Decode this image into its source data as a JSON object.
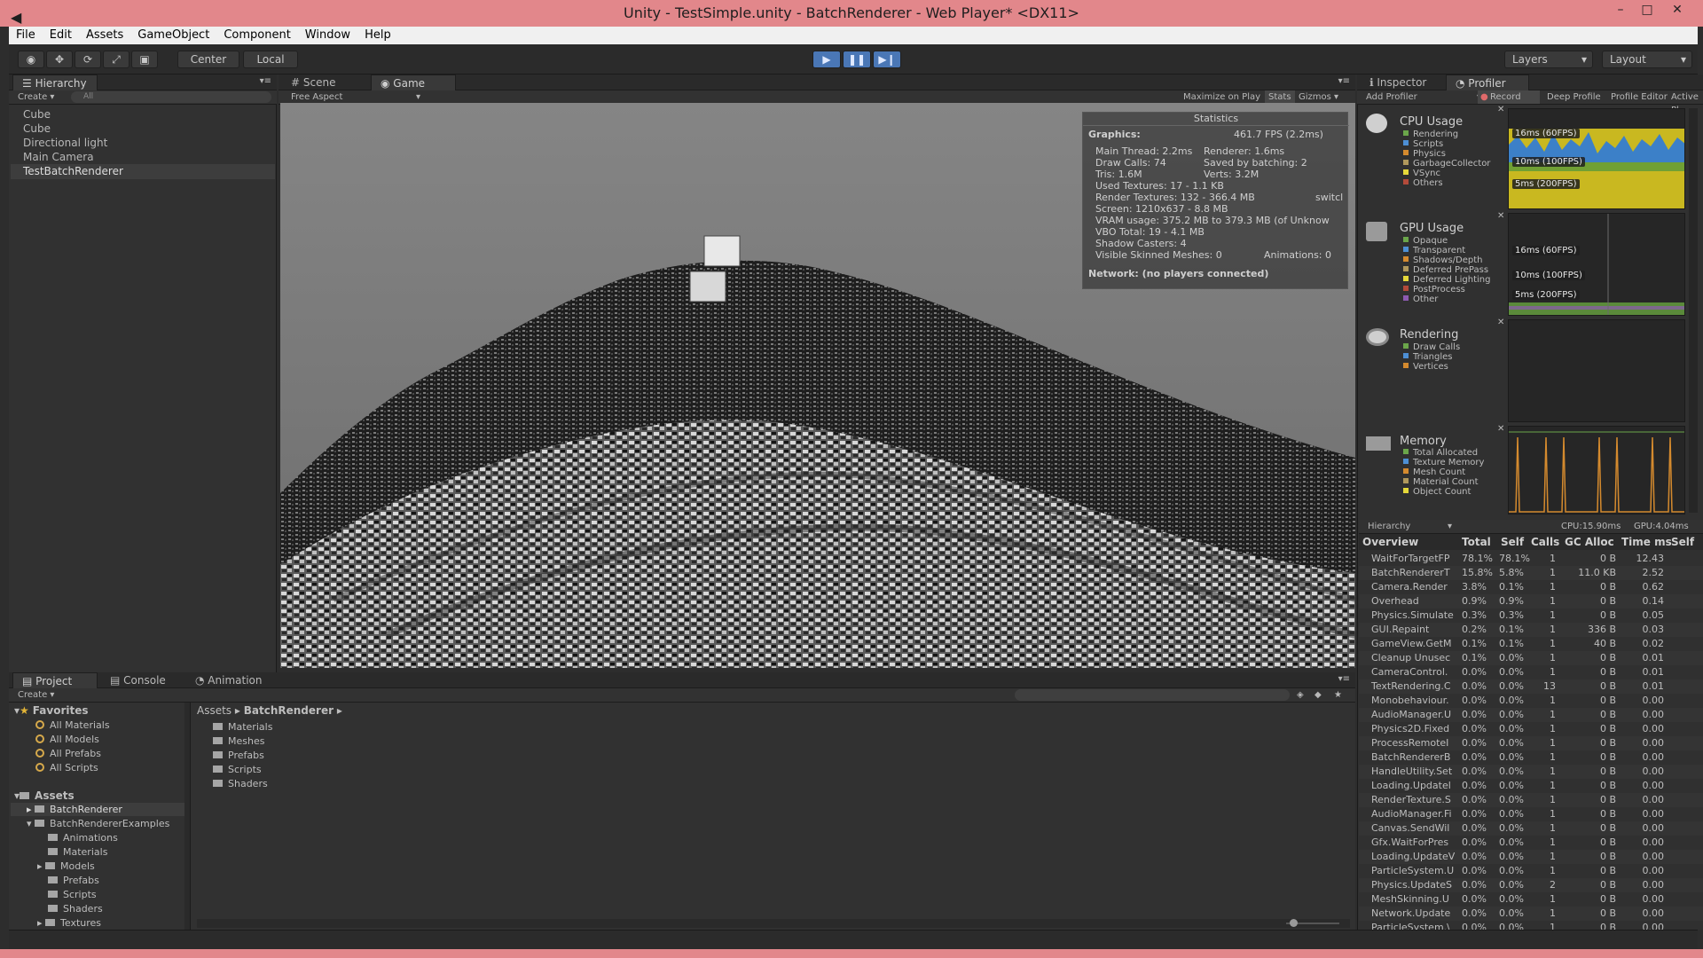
{
  "window": {
    "title": "Unity - TestSimple.unity - BatchRenderer - Web Player* <DX11>",
    "controls": [
      "–",
      "□",
      "✕"
    ]
  },
  "menu": [
    "File",
    "Edit",
    "Assets",
    "GameObject",
    "Component",
    "Window",
    "Help"
  ],
  "toolbar": {
    "center": "Center",
    "local": "Local",
    "layers": "Layers",
    "layout": "Layout"
  },
  "hierarchy": {
    "tab": "Hierarchy",
    "create": "Create",
    "search_placeholder": "All",
    "items": [
      "Cube",
      "Cube",
      "Directional light",
      "Main Camera",
      "TestBatchRenderer"
    ]
  },
  "scene": {
    "tabs": [
      "Scene",
      "Game"
    ],
    "aspect": "Free Aspect",
    "options": [
      "Maximize on Play",
      "Stats",
      "Gizmos"
    ]
  },
  "stats": {
    "header": "Statistics",
    "graphics_label": "Graphics:",
    "fps": "461.7 FPS (2.2ms)",
    "main_thread": "Main Thread: 2.2ms",
    "renderer": "Renderer: 1.6ms",
    "draw_calls": "Draw Calls: 74",
    "saved_batching": "Saved by batching: 2",
    "tris": "Tris: 1.6M",
    "verts": "Verts: 3.2M",
    "used_textures": "Used Textures: 17 - 1.1 KB",
    "render_textures": "Render Textures: 132 - 366.4 MB",
    "switches": "switcl",
    "screen": "Screen: 1210x637 - 8.8 MB",
    "vram": "VRAM usage: 375.2 MB to 379.3 MB (of Unknow",
    "vbo": "VBO Total: 19 - 4.1 MB",
    "shadow_casters": "Shadow Casters: 4",
    "skinned_meshes": "Visible Skinned Meshes: 0",
    "animations": "Animations: 0",
    "network": "Network: (no players connected)"
  },
  "inspector": {
    "tabs": [
      "Inspector",
      "Profiler"
    ],
    "buttons": [
      "Add Profiler",
      "Record",
      "Deep Profile",
      "Profile Editor",
      "Active Pl"
    ],
    "cpu": {
      "label": "CPU Usage",
      "legend": [
        "Rendering",
        "Scripts",
        "Physics",
        "GarbageCollector",
        "VSync",
        "Others"
      ],
      "marks": [
        "16ms (60FPS)",
        "10ms (100FPS)",
        "5ms (200FPS)"
      ]
    },
    "gpu": {
      "label": "GPU Usage",
      "legend": [
        "Opaque",
        "Transparent",
        "Shadows/Depth",
        "Deferred PrePass",
        "Deferred Lighting",
        "PostProcess",
        "Other"
      ],
      "marks": [
        "16ms (60FPS)",
        "10ms (100FPS)",
        "5ms (200FPS)"
      ]
    },
    "rendering": {
      "label": "Rendering",
      "legend": [
        "Draw Calls",
        "Triangles",
        "Vertices"
      ]
    },
    "memory": {
      "label": "Memory",
      "legend": [
        "Total Allocated",
        "Texture Memory",
        "Mesh Count",
        "Material Count",
        "Object Count"
      ]
    },
    "hier_mode": "Hierarchy",
    "cpu_time": "CPU:15.90ms",
    "gpu_time": "GPU:4.04ms",
    "columns": [
      "Overview",
      "Total",
      "Self",
      "Calls",
      "GC Alloc",
      "Time ms",
      "Self"
    ],
    "rows": [
      [
        "WaitForTargetFP",
        "78.1%",
        "78.1%",
        "1",
        "0 B",
        "12.43"
      ],
      [
        "BatchRendererT",
        "15.8%",
        "5.8%",
        "1",
        "11.0 KB",
        "2.52"
      ],
      [
        "Camera.Render",
        "3.8%",
        "0.1%",
        "1",
        "0 B",
        "0.62"
      ],
      [
        "Overhead",
        "0.9%",
        "0.9%",
        "1",
        "0 B",
        "0.14"
      ],
      [
        "Physics.Simulate",
        "0.3%",
        "0.3%",
        "1",
        "0 B",
        "0.05"
      ],
      [
        "GUI.Repaint",
        "0.2%",
        "0.1%",
        "1",
        "336 B",
        "0.03"
      ],
      [
        "GameView.GetM",
        "0.1%",
        "0.1%",
        "1",
        "40 B",
        "0.02"
      ],
      [
        "Cleanup Unusec",
        "0.1%",
        "0.0%",
        "1",
        "0 B",
        "0.01"
      ],
      [
        "CameraControl.",
        "0.0%",
        "0.0%",
        "1",
        "0 B",
        "0.01"
      ],
      [
        "TextRendering.C",
        "0.0%",
        "0.0%",
        "13",
        "0 B",
        "0.01"
      ],
      [
        "Monobehaviour.",
        "0.0%",
        "0.0%",
        "1",
        "0 B",
        "0.00"
      ],
      [
        "AudioManager.U",
        "0.0%",
        "0.0%",
        "1",
        "0 B",
        "0.00"
      ],
      [
        "Physics2D.Fixed",
        "0.0%",
        "0.0%",
        "1",
        "0 B",
        "0.00"
      ],
      [
        "ProcessRemoteI",
        "0.0%",
        "0.0%",
        "1",
        "0 B",
        "0.00"
      ],
      [
        "BatchRendererB",
        "0.0%",
        "0.0%",
        "1",
        "0 B",
        "0.00"
      ],
      [
        "HandleUtility.Set",
        "0.0%",
        "0.0%",
        "1",
        "0 B",
        "0.00"
      ],
      [
        "Loading.Updatel",
        "0.0%",
        "0.0%",
        "1",
        "0 B",
        "0.00"
      ],
      [
        "RenderTexture.S",
        "0.0%",
        "0.0%",
        "1",
        "0 B",
        "0.00"
      ],
      [
        "AudioManager.Fi",
        "0.0%",
        "0.0%",
        "1",
        "0 B",
        "0.00"
      ],
      [
        "Canvas.SendWil",
        "0.0%",
        "0.0%",
        "1",
        "0 B",
        "0.00"
      ],
      [
        "Gfx.WaitForPres",
        "0.0%",
        "0.0%",
        "1",
        "0 B",
        "0.00"
      ],
      [
        "Loading.UpdateV",
        "0.0%",
        "0.0%",
        "1",
        "0 B",
        "0.00"
      ],
      [
        "ParticleSystem.U",
        "0.0%",
        "0.0%",
        "1",
        "0 B",
        "0.00"
      ],
      [
        "Physics.UpdateS",
        "0.0%",
        "0.0%",
        "2",
        "0 B",
        "0.00"
      ],
      [
        "MeshSkinning.U",
        "0.0%",
        "0.0%",
        "1",
        "0 B",
        "0.00"
      ],
      [
        "Network.Update",
        "0.0%",
        "0.0%",
        "1",
        "0 B",
        "0.00"
      ],
      [
        "ParticleSystem.\\",
        "0.0%",
        "0.0%",
        "1",
        "0 B",
        "0.00"
      ]
    ]
  },
  "project": {
    "tabs": [
      "Project",
      "Console",
      "Animation"
    ],
    "create": "Create",
    "favorites_label": "Favorites",
    "favorites": [
      "All Materials",
      "All Models",
      "All Prefabs",
      "All Scripts"
    ],
    "assets_label": "Assets",
    "tree": [
      "BatchRenderer",
      "BatchRendererExamples",
      "Animations",
      "Materials",
      "Models",
      "Prefabs",
      "Scripts",
      "Shaders",
      "Textures"
    ],
    "breadcrumb": [
      "Assets",
      "BatchRenderer"
    ],
    "folders": [
      "Materials",
      "Meshes",
      "Prefabs",
      "Scripts",
      "Shaders"
    ]
  }
}
